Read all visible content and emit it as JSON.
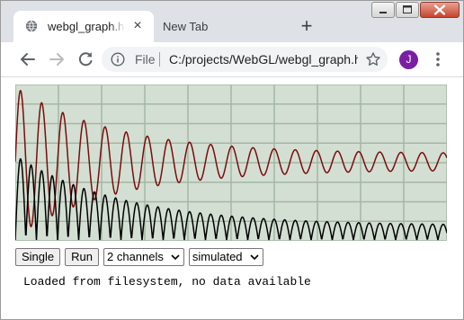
{
  "browser": {
    "active_tab": {
      "title": "webgl_graph.html",
      "close_glyph": "×",
      "icon": "globe-icon"
    },
    "inactive_tab": {
      "title": "New Tab"
    },
    "new_tab_glyph": "+",
    "address": {
      "scheme_label": "File",
      "url": "C:/projects/WebGL/webgl_graph.html"
    },
    "avatar_letter": "J",
    "avatar_color": "#7b1fa2",
    "window_controls": [
      "minimize",
      "maximize",
      "close"
    ]
  },
  "page": {
    "graph": {
      "background": "#d3dfd3",
      "grid_color": "#a3b7a3",
      "channels": [
        {
          "color": "#7b0c0c",
          "icon": "damped-sine-trace"
        },
        {
          "color": "#000000",
          "icon": "damped-sine-trace"
        }
      ]
    },
    "controls": {
      "single_label": "Single",
      "run_label": "Run",
      "channels_select_value": "2 channels",
      "source_select_value": "simulated"
    },
    "status": "Loaded from filesystem, no data available"
  }
}
